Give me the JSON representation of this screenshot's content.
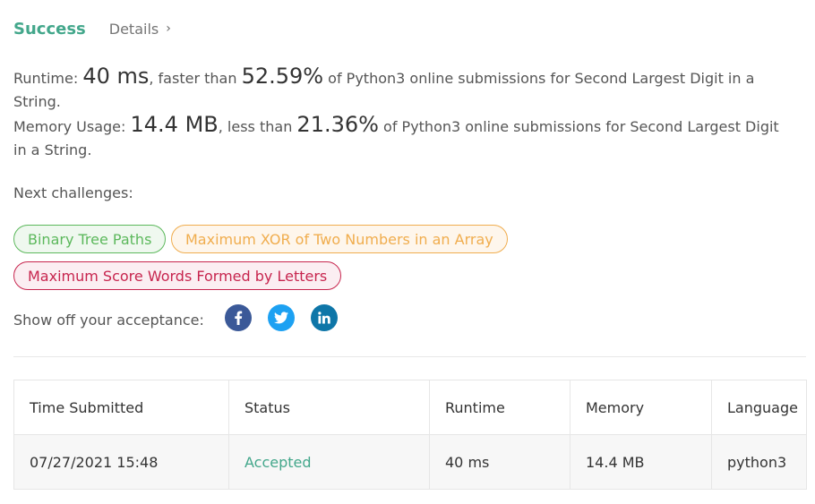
{
  "header": {
    "status": "Success",
    "details_label": "Details",
    "details_chevron": "›"
  },
  "runtime": {
    "label": "Runtime:",
    "value": "40 ms",
    "faster_than": ", faster than",
    "percent": "52.59%",
    "suffix": "of Python3 online submissions for Second Largest Digit in a String."
  },
  "memory": {
    "label": "Memory Usage:",
    "value": "14.4 MB",
    "less_than": ", less than",
    "percent": "21.36%",
    "suffix": "of Python3 online submissions for Second Largest Digit in a String."
  },
  "next": {
    "label": "Next challenges:",
    "challenges": [
      {
        "label": "Binary Tree Paths",
        "color": "#5cb85c"
      },
      {
        "label": "Maximum XOR of Two Numbers in an Array",
        "color": "#f0ad4e"
      },
      {
        "label": "Maximum Score Words Formed by Letters",
        "color": "#c7254e"
      }
    ]
  },
  "share": {
    "label": "Show off your acceptance:",
    "icons": [
      "facebook-icon",
      "twitter-icon",
      "linkedin-icon"
    ]
  },
  "table": {
    "headers": [
      "Time Submitted",
      "Status",
      "Runtime",
      "Memory",
      "Language"
    ],
    "rows": [
      [
        "07/27/2021 15:48",
        "Accepted",
        "40 ms",
        "14.4 MB",
        "python3"
      ]
    ]
  },
  "colors": {
    "accent": "#43a78b"
  }
}
